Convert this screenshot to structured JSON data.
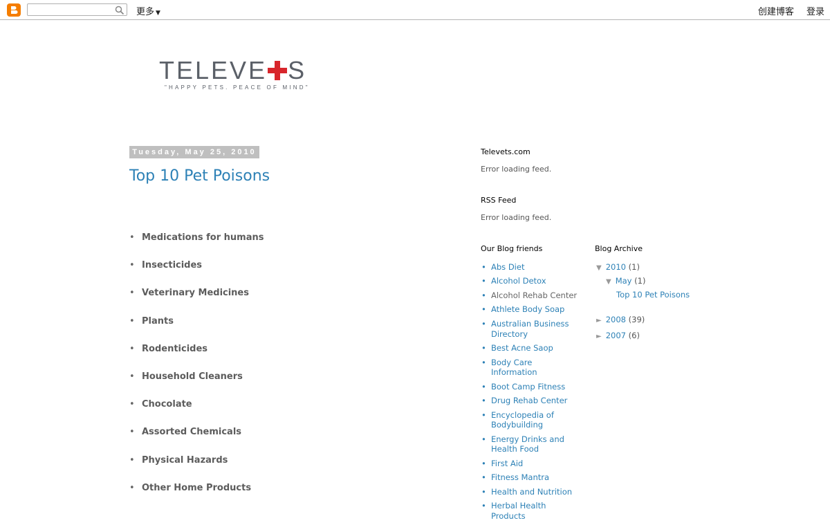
{
  "navbar": {
    "search_placeholder": "",
    "more_label": "更多",
    "create_blog": "创建博客",
    "login": "登录"
  },
  "header": {
    "logo_text_left": "TELEVE",
    "logo_text_right": "S",
    "tagline": "\"HAPPY PETS. PEACE OF MIND\""
  },
  "post": {
    "date": "Tuesday, May 25, 2010",
    "title": "Top 10 Pet Poisons",
    "items": [
      "Medications for humans",
      "Insecticides",
      "Veterinary Medicines",
      "Plants",
      "Rodenticides",
      "Household Cleaners",
      "Chocolate",
      "Assorted Chemicals",
      "Physical Hazards",
      "Other Home Products"
    ]
  },
  "sidebar": {
    "televets_title": "Televets.com",
    "televets_error": "Error loading feed.",
    "rss_title": "RSS Feed",
    "rss_error": "Error loading feed.",
    "friends_title": "Our Blog friends",
    "friends": [
      "Abs Diet",
      "Alcohol Detox",
      "Alcohol Rehab Center",
      "Athlete Body Soap",
      "Australian Business Directory",
      "Best Acne Saop",
      "Body Care Information",
      "Boot Camp Fitness",
      "Drug Rehab Center",
      "Encyclopedia of Bodybuilding",
      "Energy Drinks and Health Food",
      "First Aid",
      "Fitness Mantra",
      "Health and Nutrition",
      "Herbal Health Products"
    ],
    "archive_title": "Blog Archive",
    "archive": {
      "y2010": "2010",
      "y2010_count": "(1)",
      "may": "May",
      "may_count": "(1)",
      "post": "Top 10 Pet Poisons",
      "y2008": "2008",
      "y2008_count": "(39)",
      "y2007": "2007",
      "y2007_count": "(6)"
    }
  },
  "colors": {
    "link": "#2d81b6",
    "blogger_orange": "#f57d00",
    "logo_red": "#d8262c",
    "date_bg": "#bfbfbf"
  }
}
